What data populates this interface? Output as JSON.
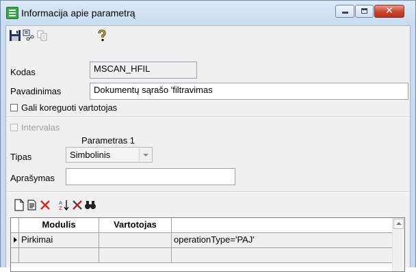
{
  "window": {
    "title": "Informacija apie parametrą",
    "icon": "list-app-icon",
    "buttons": [
      "minimize",
      "maximize",
      "close"
    ],
    "close_glyph": "✕"
  },
  "toolbar": {
    "icons": [
      "save-icon",
      "properties-icon",
      "copy-icon",
      "help-icon"
    ]
  },
  "form": {
    "kodas_label": "Kodas",
    "kodas_value": "MSCAN_HFIL",
    "pavadinimas_label": "Pavadinimas",
    "pavadinimas_value": "Dokumentų sąrašo 'filtravimas",
    "gali_label": "Gali koreguoti vartotojas",
    "gali_checked": false
  },
  "param": {
    "intervalas_label": "Intervalas",
    "intervalas_checked": false,
    "parametras_header": "Parametras 1",
    "tipas_label": "Tipas",
    "tipas_value": "Simbolinis",
    "aprasymas_label": "Aprašymas",
    "aprasymas_value": ""
  },
  "grid_toolbar": {
    "icons": [
      "new-icon",
      "edit-icon",
      "delete-icon",
      "sort-icon",
      "tools-icon",
      "find-icon"
    ]
  },
  "grid": {
    "columns": [
      "Modulis",
      "Vartotojas",
      ""
    ],
    "rows": [
      {
        "modulis": "Pirkimai",
        "vartotojas": "",
        "reiksme": "operationType='PAJ'"
      }
    ]
  },
  "colors": {
    "client_bg": "#f0f0f0",
    "close_button": "#c9442f",
    "delete_red": "#d32a1f"
  }
}
